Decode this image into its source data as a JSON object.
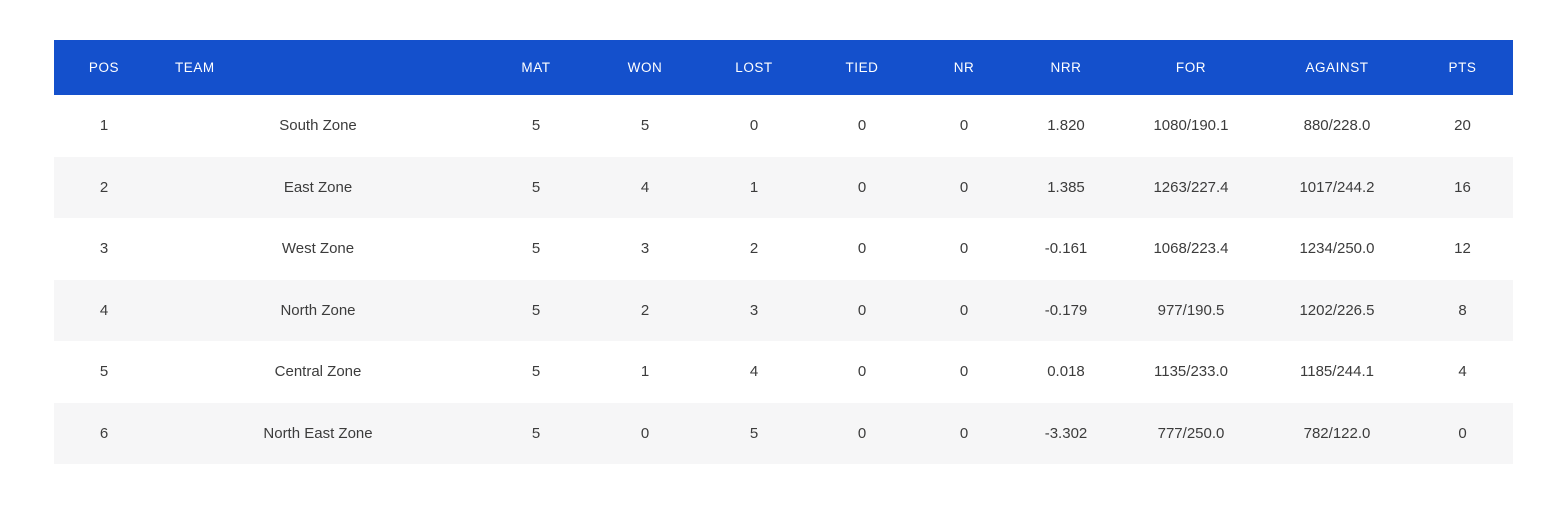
{
  "table": {
    "accent_header_bg": "#1450CC",
    "header_text_color": "#FFFFFF",
    "points_color": "#D2441F",
    "team_color": "#121A3E",
    "row_alt_bg": "#F6F6F7",
    "columns": [
      {
        "key": "pos",
        "label": "POS"
      },
      {
        "key": "team",
        "label": "TEAM"
      },
      {
        "key": "mat",
        "label": "MAT"
      },
      {
        "key": "won",
        "label": "WON"
      },
      {
        "key": "lost",
        "label": "LOST"
      },
      {
        "key": "tied",
        "label": "TIED"
      },
      {
        "key": "nr",
        "label": "NR"
      },
      {
        "key": "nrr",
        "label": "NRR"
      },
      {
        "key": "for",
        "label": "FOR"
      },
      {
        "key": "against",
        "label": "AGAINST"
      },
      {
        "key": "pts",
        "label": "PTS"
      }
    ],
    "rows": [
      {
        "pos": "1",
        "team": "South Zone",
        "mat": "5",
        "won": "5",
        "lost": "0",
        "tied": "0",
        "nr": "0",
        "nrr": "1.820",
        "for": "1080/190.1",
        "against": "880/228.0",
        "pts": "20"
      },
      {
        "pos": "2",
        "team": "East Zone",
        "mat": "5",
        "won": "4",
        "lost": "1",
        "tied": "0",
        "nr": "0",
        "nrr": "1.385",
        "for": "1263/227.4",
        "against": "1017/244.2",
        "pts": "16"
      },
      {
        "pos": "3",
        "team": "West Zone",
        "mat": "5",
        "won": "3",
        "lost": "2",
        "tied": "0",
        "nr": "0",
        "nrr": "-0.161",
        "for": "1068/223.4",
        "against": "1234/250.0",
        "pts": "12"
      },
      {
        "pos": "4",
        "team": "North Zone",
        "mat": "5",
        "won": "2",
        "lost": "3",
        "tied": "0",
        "nr": "0",
        "nrr": "-0.179",
        "for": "977/190.5",
        "against": "1202/226.5",
        "pts": "8"
      },
      {
        "pos": "5",
        "team": "Central Zone",
        "mat": "5",
        "won": "1",
        "lost": "4",
        "tied": "0",
        "nr": "0",
        "nrr": "0.018",
        "for": "1135/233.0",
        "against": "1185/244.1",
        "pts": "4"
      },
      {
        "pos": "6",
        "team": "North East Zone",
        "mat": "5",
        "won": "0",
        "lost": "5",
        "tied": "0",
        "nr": "0",
        "nrr": "-3.302",
        "for": "777/250.0",
        "against": "782/122.0",
        "pts": "0"
      }
    ]
  }
}
